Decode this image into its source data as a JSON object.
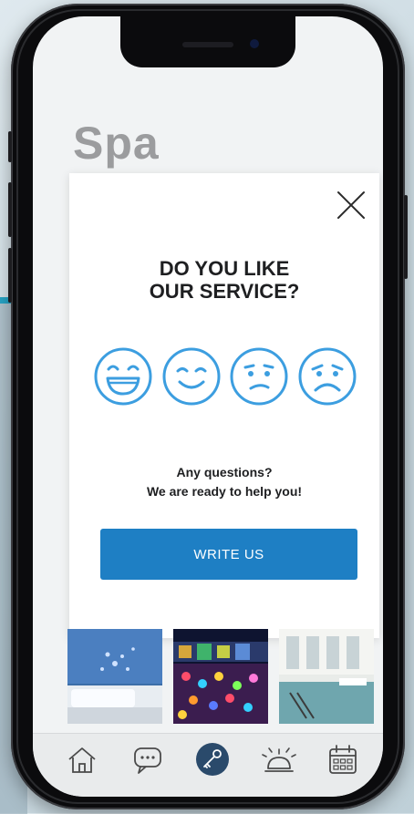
{
  "app": {
    "title": "Spa"
  },
  "modal": {
    "question_line1": "DO YOU LIKE",
    "question_line2": "OUR SERVICE?",
    "rating_faces": [
      "very-happy-face-icon",
      "happy-face-icon",
      "unsure-face-icon",
      "sad-face-icon"
    ],
    "help_line1": "Any questions?",
    "help_line2": "We are ready to help you!",
    "write_button_label": "WRITE US",
    "close_icon": "close-icon"
  },
  "gallery": {
    "photos": [
      "hotel-room-photo",
      "illuminated-square-photo",
      "indoor-pool-photo"
    ]
  },
  "tabbar": {
    "items": [
      "home-icon",
      "chat-icon",
      "key-icon",
      "reception-bell-icon",
      "calendar-icon"
    ],
    "active": "key-icon"
  },
  "colors": {
    "accent": "#1e7fc4",
    "face_stroke": "#3c9ee0",
    "title_gray": "#9b9c9e",
    "tab_active_bg": "#2a4a6b"
  }
}
